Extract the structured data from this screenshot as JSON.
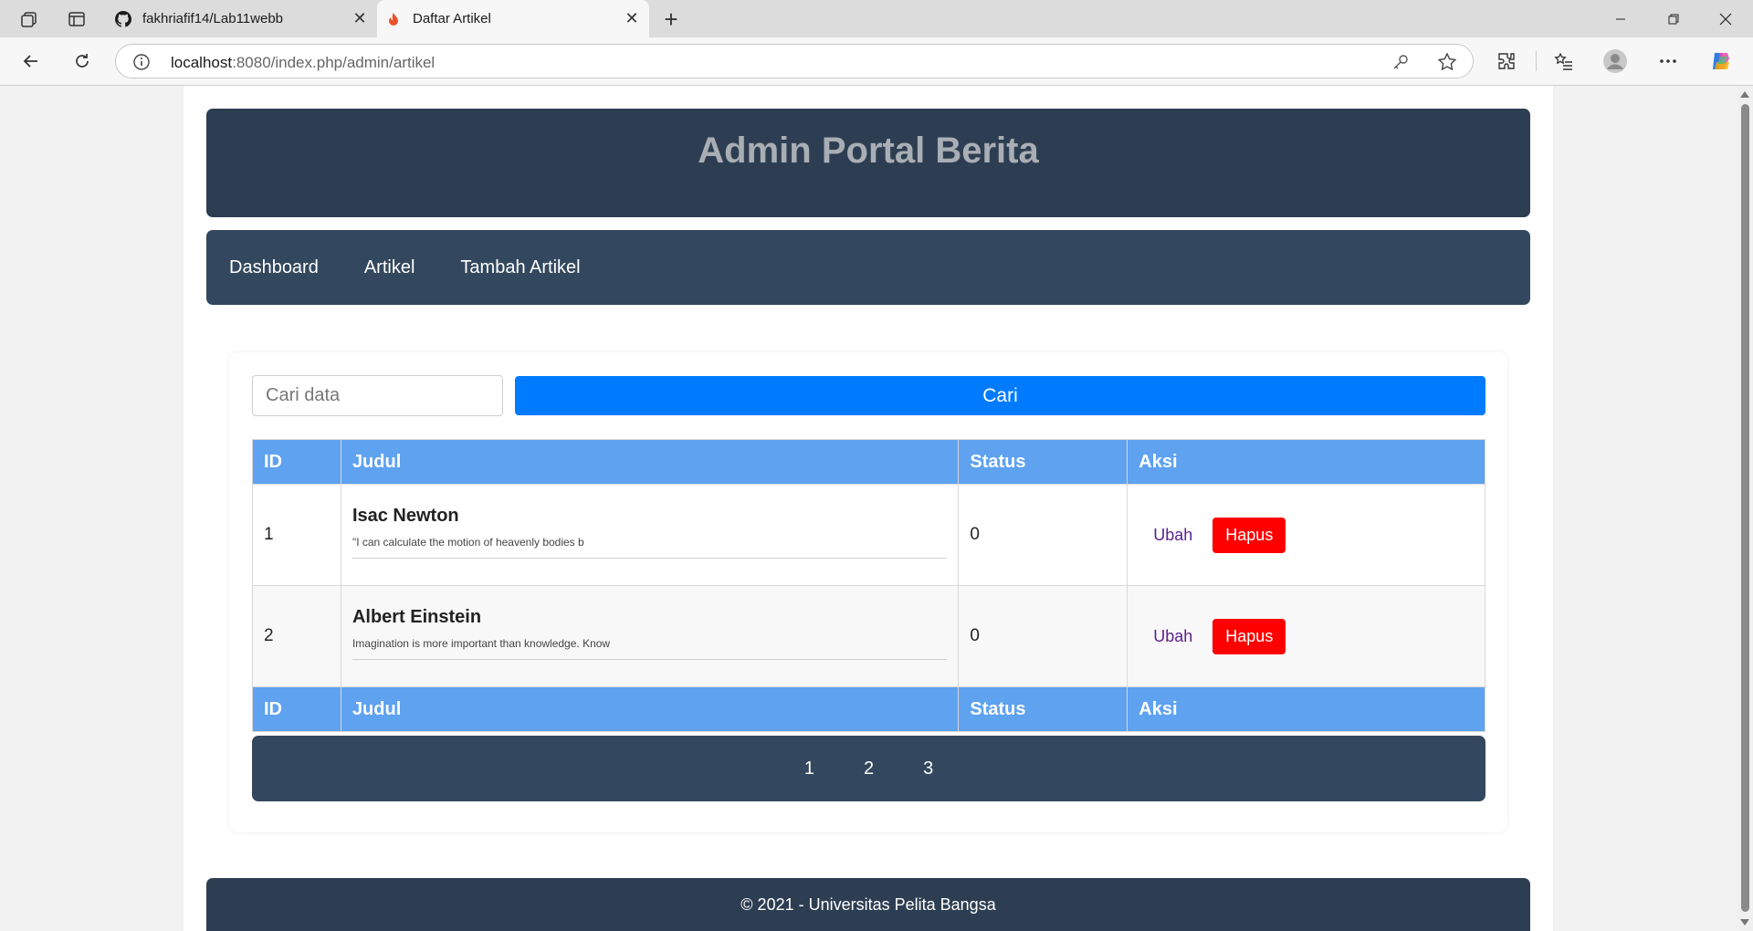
{
  "browser": {
    "tabs": [
      {
        "title": "fakhriafif14/Lab11webb",
        "icon": "github-icon"
      },
      {
        "title": "Daftar Artikel",
        "icon": "flame-icon"
      }
    ],
    "address": {
      "host": "localhost",
      "rest": ":8080/index.php/admin/artikel"
    }
  },
  "header": {
    "title": "Admin Portal Berita"
  },
  "nav": {
    "items": [
      "Dashboard",
      "Artikel",
      "Tambah Artikel"
    ]
  },
  "search": {
    "placeholder": "Cari data",
    "button": "Cari"
  },
  "table": {
    "columns": [
      "ID",
      "Judul",
      "Status",
      "Aksi"
    ],
    "rows": [
      {
        "id": "1",
        "title": "Isac Newton",
        "excerpt": "\"I can calculate the motion of heavenly bodies b",
        "status": "0",
        "edit": "Ubah",
        "delete": "Hapus"
      },
      {
        "id": "2",
        "title": "Albert Einstein",
        "excerpt": "Imagination is more important than knowledge. Know",
        "status": "0",
        "edit": "Ubah",
        "delete": "Hapus"
      }
    ]
  },
  "pagination": {
    "pages": [
      "1",
      "2",
      "3"
    ]
  },
  "footer": {
    "text": "© 2021 - Universitas Pelita Bangsa"
  },
  "colors": {
    "header": "#2e3e52",
    "nav": "#33485e",
    "table_head": "#5ea2f0",
    "search_button": "#007bff",
    "delete_button": "#ff0000",
    "edit_link": "#5b1f8a"
  }
}
